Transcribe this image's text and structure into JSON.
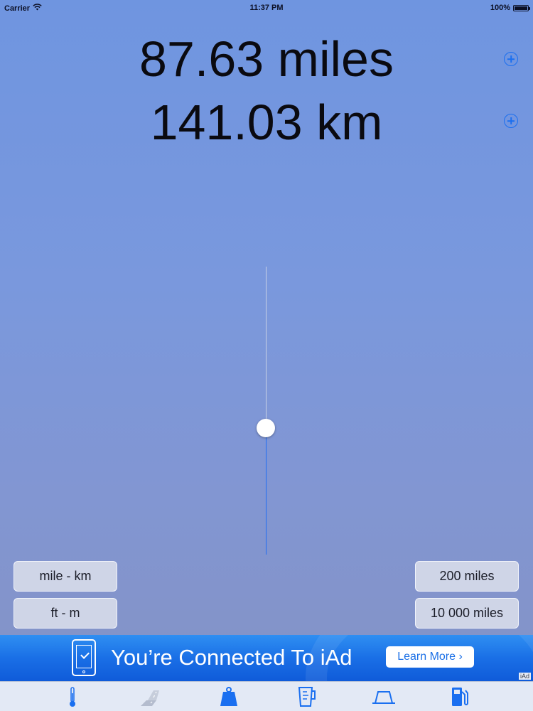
{
  "status_bar": {
    "carrier": "Carrier",
    "time": "11:37 PM",
    "battery": "100%",
    "battery_level": 1.0
  },
  "readouts": {
    "miles": "87.63 miles",
    "km": "141.03 km"
  },
  "slider": {
    "value_fraction": 0.44
  },
  "buttons": {
    "mile_km": "mile - km",
    "ft_m": "ft - m",
    "range_200": "200 miles",
    "range_10000": "10 000 miles"
  },
  "ad": {
    "headline": "You’re Connected To iAd",
    "cta": "Learn More ›",
    "tag": "iAd"
  },
  "tabs": [
    {
      "icon": "thermometer-icon",
      "selected": false
    },
    {
      "icon": "road-distance-icon",
      "selected": true
    },
    {
      "icon": "weight-icon",
      "selected": false
    },
    {
      "icon": "measuring-cup-icon",
      "selected": false
    },
    {
      "icon": "area-icon",
      "selected": false
    },
    {
      "icon": "fuel-pump-icon",
      "selected": false
    }
  ],
  "colors": {
    "accent": "#1a6ff0",
    "tab_selected": "#c4cbd9"
  }
}
